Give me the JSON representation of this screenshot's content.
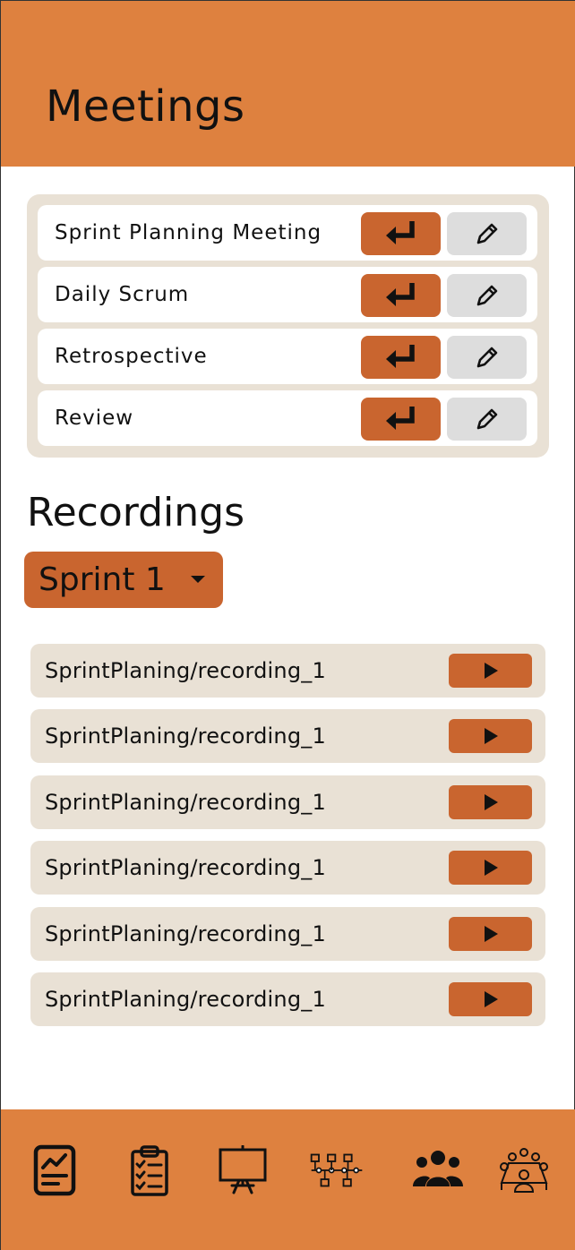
{
  "header": {
    "title": "Meetings"
  },
  "meetings": [
    {
      "label": "Sprint Planning Meeting",
      "enter_icon": "enter-icon",
      "edit_icon": "pencil-icon"
    },
    {
      "label": "Daily Scrum",
      "enter_icon": "enter-icon",
      "edit_icon": "pencil-icon"
    },
    {
      "label": "Retrospective",
      "enter_icon": "enter-icon",
      "edit_icon": "pencil-icon"
    },
    {
      "label": "Review",
      "enter_icon": "enter-icon",
      "edit_icon": "pencil-icon"
    }
  ],
  "recordings": {
    "title": "Recordings",
    "sprint_select": "Sprint 1",
    "items": [
      {
        "label": "SprintPlaning/recording_1"
      },
      {
        "label": "SprintPlaning/recording_1"
      },
      {
        "label": "SprintPlaning/recording_1"
      },
      {
        "label": "SprintPlaning/recording_1"
      },
      {
        "label": "SprintPlaning/recording_1"
      },
      {
        "label": "SprintPlaning/recording_1"
      }
    ]
  },
  "bottom_nav": [
    {
      "icon": "report-chart-icon"
    },
    {
      "icon": "clipboard-checklist-icon"
    },
    {
      "icon": "presentation-board-icon"
    },
    {
      "icon": "workflow-diagram-icon"
    },
    {
      "icon": "team-group-icon"
    },
    {
      "icon": "meeting-table-icon"
    }
  ],
  "colors": {
    "header_bg": "#de813f",
    "accent": "#c9652f",
    "panel_bg": "#e9e1d5",
    "edit_bg": "#dddddd"
  }
}
